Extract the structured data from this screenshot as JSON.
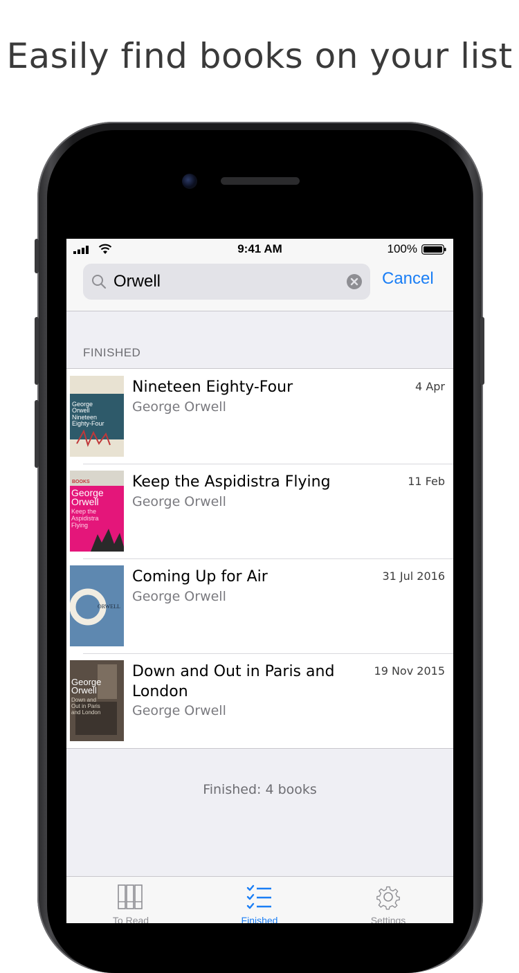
{
  "headline": "Easily find books on your list",
  "status_bar": {
    "time": "9:41 AM",
    "battery": "100%"
  },
  "search": {
    "query": "Orwell",
    "cancel_label": "Cancel"
  },
  "section_header": "FINISHED",
  "books": [
    {
      "title": "Nineteen Eighty-Four",
      "author": "George Orwell",
      "date": "4 Apr"
    },
    {
      "title": "Keep the Aspidistra Flying",
      "author": "George Orwell",
      "date": "11 Feb"
    },
    {
      "title": "Coming Up for Air",
      "author": "George Orwell",
      "date": "31 Jul 2016"
    },
    {
      "title": "Down and Out in Paris and London",
      "author": "George Orwell",
      "date": "19 Nov 2015"
    }
  ],
  "covers": [
    {
      "lines": [
        "George",
        "Orwell",
        "Nineteen",
        "Eighty-Four"
      ],
      "colors": {
        "top": "#e8e2d2",
        "main": "#2e5a6a",
        "accent": "#c0383a"
      }
    },
    {
      "lines": [
        "BOOKS",
        "George",
        "Orwell",
        "Keep the",
        "Aspidistra",
        "Flying"
      ],
      "colors": {
        "top": "#d9d6cc",
        "main": "#e4167a",
        "accent": "#2a2a2a"
      }
    },
    {
      "lines": [
        "ORWELL"
      ],
      "colors": {
        "main": "#5e88b0",
        "ring": "#f1ede2"
      }
    },
    {
      "lines": [
        "George",
        "Orwell",
        "Down and",
        "Out in Paris",
        "and London"
      ],
      "colors": {
        "main": "#5a4e44",
        "accent": "#d8d0c2"
      }
    }
  ],
  "footer": "Finished: 4 books",
  "tabs": [
    {
      "label": "To Read",
      "icon": "bookshelf-icon",
      "active": false
    },
    {
      "label": "Finished",
      "icon": "checklist-icon",
      "active": true
    },
    {
      "label": "Settings",
      "icon": "gear-icon",
      "active": false
    }
  ],
  "colors": {
    "accent": "#1a7ef5",
    "background": "#efeff4"
  }
}
